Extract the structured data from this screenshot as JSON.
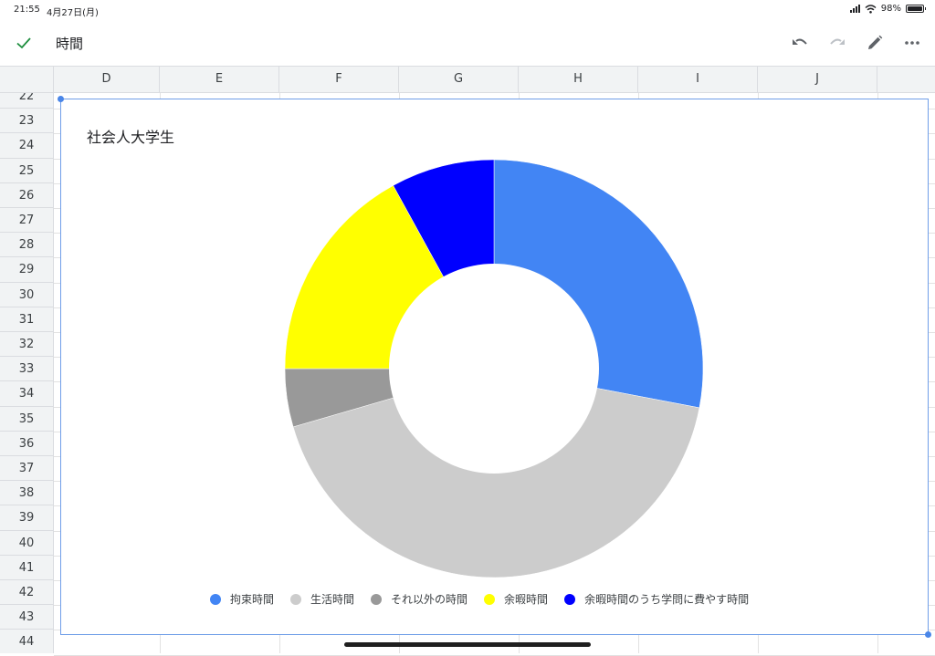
{
  "status": {
    "time": "21:55",
    "date": "4月27日(月)",
    "battery": "98%",
    "battery_level": 0.98
  },
  "toolbar": {
    "title": "時間",
    "icons": [
      "check-icon",
      "undo-icon",
      "redo-icon",
      "pencil-icon",
      "more-icon"
    ]
  },
  "columns": [
    "D",
    "E",
    "F",
    "G",
    "H",
    "I",
    "J"
  ],
  "rows": [
    "22",
    "23",
    "24",
    "25",
    "26",
    "27",
    "28",
    "29",
    "30",
    "31",
    "32",
    "33",
    "34",
    "35",
    "36",
    "37",
    "38",
    "39",
    "40",
    "41",
    "42",
    "43",
    "44"
  ],
  "colors": {
    "accent": "#4a86e8",
    "grid": "#e2e2e2",
    "header_bg": "#f1f3f4"
  },
  "chart_data": {
    "type": "pie",
    "style": "donut",
    "title": "社会人大学生",
    "legend_position": "bottom",
    "series": [
      {
        "name": "拘束時間",
        "value": 28.0,
        "color": "#4285f4"
      },
      {
        "name": "生活時間",
        "value": 42.5,
        "color": "#cccccc"
      },
      {
        "name": "それ以外の時間",
        "value": 4.5,
        "color": "#999999"
      },
      {
        "name": "余暇時間",
        "value": 17.0,
        "color": "#ffff00"
      },
      {
        "name": "余暇時間のうち学問に費やす時間",
        "value": 8.0,
        "color": "#0000ff"
      }
    ]
  }
}
